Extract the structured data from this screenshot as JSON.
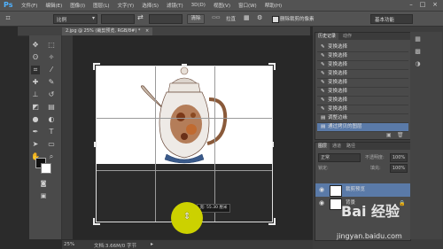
{
  "app": {
    "logo": "Ps"
  },
  "menu": [
    "文件(F)",
    "编辑(E)",
    "图像(I)",
    "图层(L)",
    "文字(Y)",
    "选择(S)",
    "滤镜(T)",
    "3D(D)",
    "视图(V)",
    "窗口(W)",
    "帮助(H)"
  ],
  "window_controls": [
    "–",
    "□",
    "×"
  ],
  "options_bar": {
    "ratio_value": "比例",
    "ratio_dropdown_icon": "chevron-down-icon",
    "swap_icon": "⇄",
    "clear_label": "清除",
    "straighten_label": "拉直",
    "delete_cropped_label": "删除裁剪的像素",
    "delete_cropped_checked": true,
    "workspace_value": "基本功能"
  },
  "document": {
    "tab_title": "2.jpg @ 25% (裁剪预览, RGB/8#) *",
    "tab_close": "×",
    "crop_tooltip": "宽: 55.30 厘米"
  },
  "status": {
    "zoom": "25%",
    "doc_size": "文档:3.66M/0 字节"
  },
  "history_panel": {
    "tabs": [
      "历史记录",
      "动作"
    ],
    "items": [
      {
        "label": "变换选择",
        "icon": "brush-icon"
      },
      {
        "label": "变换选择",
        "icon": "brush-icon"
      },
      {
        "label": "变换选择",
        "icon": "brush-icon"
      },
      {
        "label": "变换选择",
        "icon": "brush-icon"
      },
      {
        "label": "变换选择",
        "icon": "brush-icon"
      },
      {
        "label": "变换选择",
        "icon": "brush-icon"
      },
      {
        "label": "变换选择",
        "icon": "brush-icon"
      },
      {
        "label": "变换选择",
        "icon": "brush-icon"
      },
      {
        "label": "调整边缘",
        "icon": "layer-icon"
      },
      {
        "label": "通过拷贝的图层",
        "icon": "layer-icon"
      }
    ]
  },
  "layers_panel": {
    "tabs": [
      "图层",
      "通道",
      "路径"
    ],
    "blend_mode": "正常",
    "opacity_label": "不透明度:",
    "opacity_value": "100%",
    "lock_label": "锁定:",
    "fill_label": "填充:",
    "fill_value": "100%",
    "layers": [
      {
        "name": "裁剪预览",
        "selected": true
      },
      {
        "name": "背景",
        "selected": false
      }
    ]
  },
  "watermark": {
    "text": "Bai 经验",
    "url": "jingyan.baidu.com"
  },
  "colors": {
    "accent_select": "#5a7aa8",
    "cursor_highlight": "#ccd100"
  }
}
